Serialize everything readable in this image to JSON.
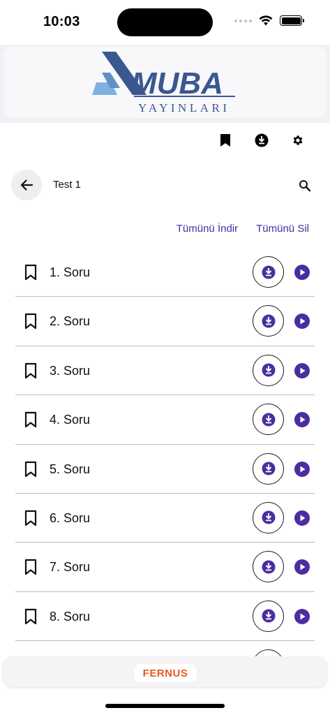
{
  "status_bar": {
    "time": "10:03"
  },
  "brand": {
    "name": "MUBA",
    "subtitle": "YAYINLARI",
    "colors": {
      "primary": "#3a5790",
      "light": "#7fb2e0"
    }
  },
  "toolbar": {
    "icons": [
      "bookmark-icon",
      "download-icon",
      "settings-icon"
    ]
  },
  "header": {
    "title": "Test 1"
  },
  "actions": {
    "download_all": "Tümünü İndir",
    "delete_all": "Tümünü Sil"
  },
  "questions": [
    {
      "label": "1. Soru"
    },
    {
      "label": "2. Soru"
    },
    {
      "label": "3. Soru"
    },
    {
      "label": "4. Soru"
    },
    {
      "label": "5. Soru"
    },
    {
      "label": "6. Soru"
    },
    {
      "label": "7. Soru"
    },
    {
      "label": "8. Soru"
    }
  ],
  "footer": {
    "logo_text": "FERNUS"
  },
  "colors": {
    "accent": "#4a2ea0",
    "footer_brand": "#e35b24"
  }
}
